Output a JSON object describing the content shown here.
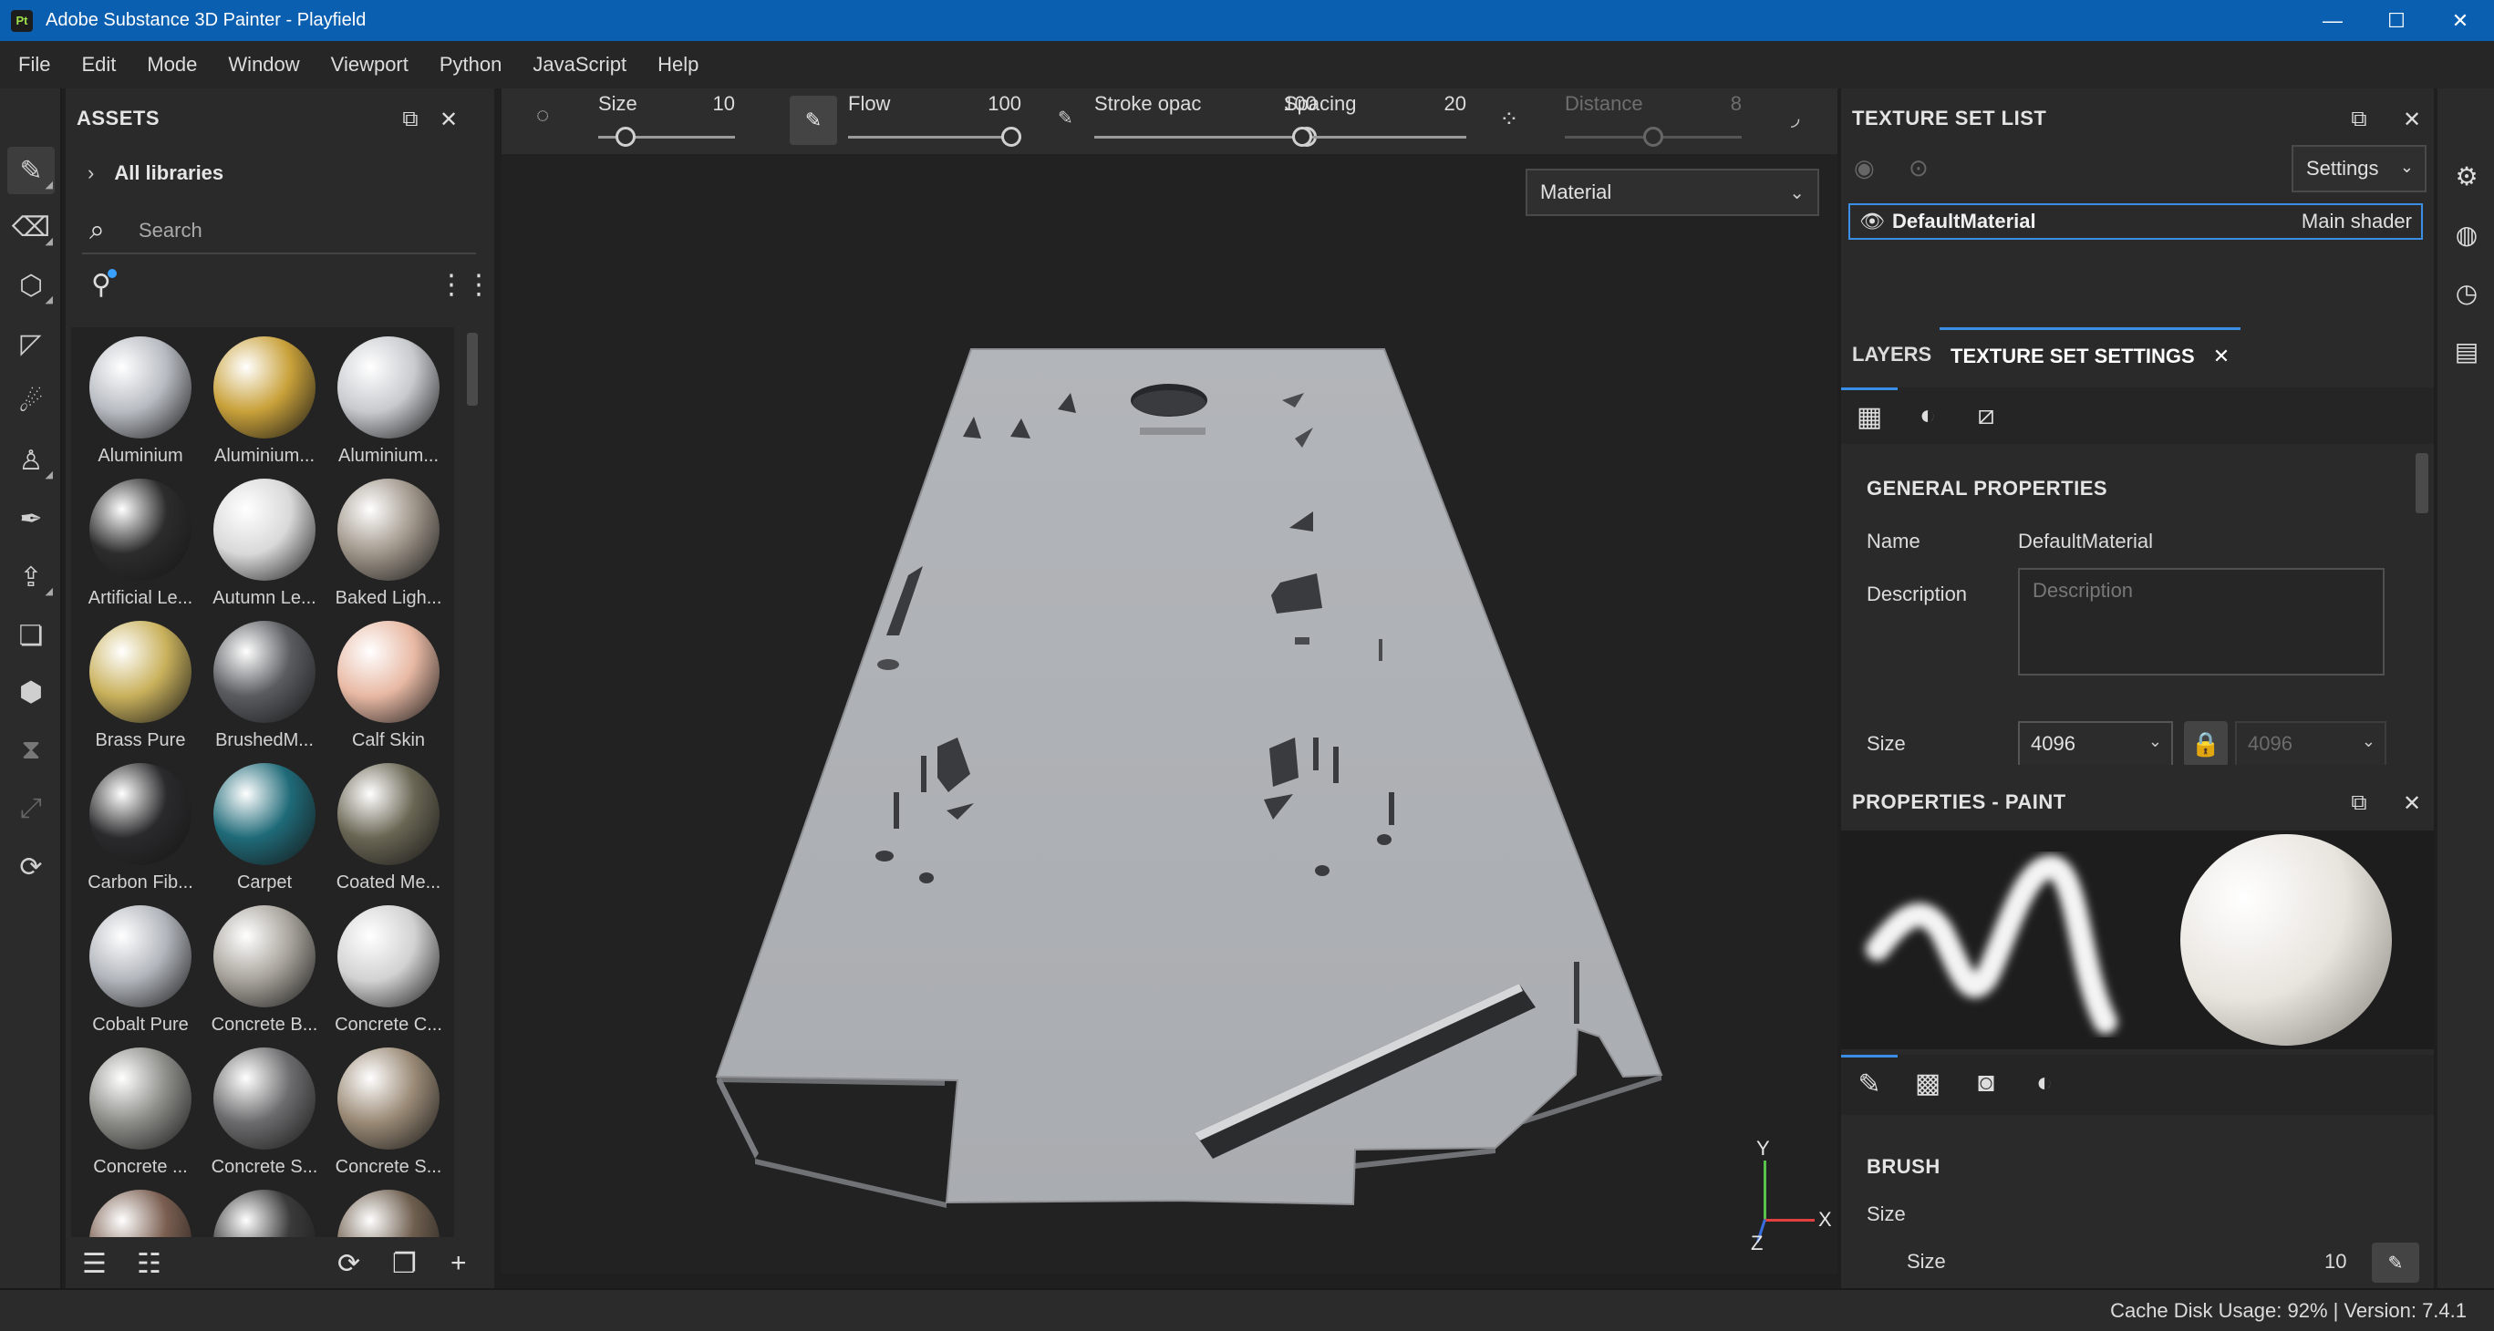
{
  "window": {
    "title": "Adobe Substance 3D Painter - Playfield",
    "app_icon": "Pt",
    "controls": {
      "minimize": "—",
      "maximize": "☐",
      "close": "✕"
    }
  },
  "menu": [
    "File",
    "Edit",
    "Mode",
    "Window",
    "Viewport",
    "Python",
    "JavaScript",
    "Help"
  ],
  "assets": {
    "title": "ASSETS",
    "breadcrumb": "All libraries",
    "search_placeholder": "Search",
    "materials": [
      {
        "label": "Aluminium",
        "color": "#b8bcc2"
      },
      {
        "label": "Aluminium...",
        "color": "#c9a13a"
      },
      {
        "label": "Aluminium...",
        "color": "#c8cace"
      },
      {
        "label": "Artificial Le...",
        "color": "#2c2c2c"
      },
      {
        "label": "Autumn Le...",
        "color": "#d9d9d9"
      },
      {
        "label": "Baked Ligh...",
        "color": "#a0968a"
      },
      {
        "label": "Brass Pure",
        "color": "#c9b15c"
      },
      {
        "label": "BrushedM...",
        "color": "#5a5c60"
      },
      {
        "label": "Calf Skin",
        "color": "#e8b9a4"
      },
      {
        "label": "Carbon Fib...",
        "color": "#2a2a2c"
      },
      {
        "label": "Carpet",
        "color": "#1f6a78"
      },
      {
        "label": "Coated Me...",
        "color": "#6a6654"
      },
      {
        "label": "Cobalt Pure",
        "color": "#b2b6bc"
      },
      {
        "label": "Concrete B...",
        "color": "#a8a49c"
      },
      {
        "label": "Concrete C...",
        "color": "#d2d2d2"
      },
      {
        "label": "Concrete ...",
        "color": "#8c8c88"
      },
      {
        "label": "Concrete S...",
        "color": "#6c6c6e"
      },
      {
        "label": "Concrete S...",
        "color": "#9a8a76"
      },
      {
        "label": "",
        "color": "#7a5e50"
      },
      {
        "label": "",
        "color": "#3a3a3a"
      },
      {
        "label": "",
        "color": "#6e5e4e"
      }
    ]
  },
  "toolbar": {
    "size": {
      "label": "Size",
      "value": "10",
      "level": 0.15
    },
    "flow": {
      "label": "Flow",
      "value": "100",
      "level": 1.0
    },
    "stroke_opacity": {
      "label": "Stroke opac",
      "value": "100",
      "level": 1.0
    },
    "spacing": {
      "label": "Spacing",
      "value": "20",
      "level": 0.05
    },
    "distance": {
      "label": "Distance",
      "value": "8",
      "level": 0.5
    }
  },
  "viewport": {
    "material_mode": "Material",
    "axes": {
      "y": "Y",
      "x": "X",
      "z": "Z"
    }
  },
  "texture_set_list": {
    "title": "TEXTURE SET LIST",
    "settings_label": "Settings",
    "row_name": "DefaultMaterial",
    "row_shader": "Main shader"
  },
  "tabs": {
    "layers": "LAYERS",
    "tss": "TEXTURE SET SETTINGS"
  },
  "general": {
    "title": "GENERAL PROPERTIES",
    "name_label": "Name",
    "name_value": "DefaultMaterial",
    "desc_label": "Description",
    "desc_placeholder": "Description",
    "size_label": "Size",
    "size_value": "4096",
    "size_value2": "4096"
  },
  "paint": {
    "title": "PROPERTIES - PAINT",
    "brush_title": "BRUSH",
    "size_group": "Size",
    "size_label": "Size",
    "size_value": "10"
  },
  "status": "Cache Disk Usage: 92% | Version: 7.4.1",
  "colors": {
    "accent": "#3a8ee6",
    "titlebar": "#0a5fb0"
  }
}
